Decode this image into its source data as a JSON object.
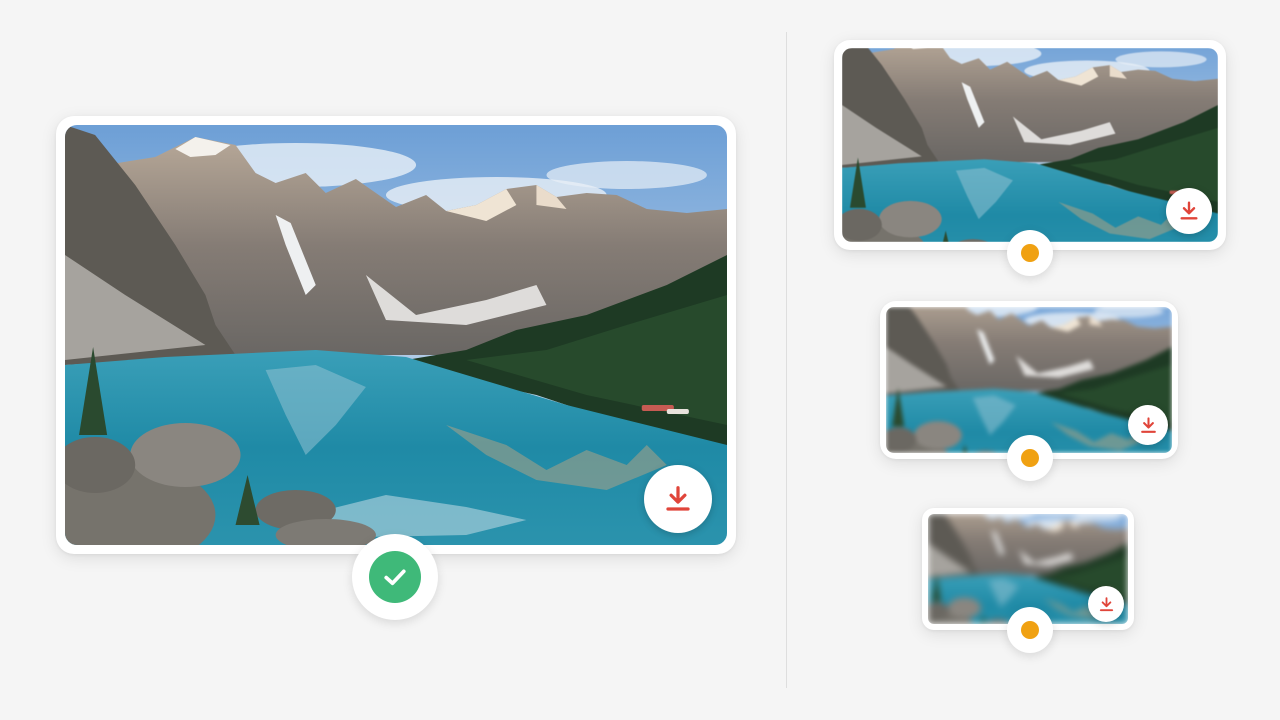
{
  "colors": {
    "background": "#f5f5f5",
    "card": "#ffffff",
    "download_icon": "#e0453a",
    "success_badge": "#3fb979",
    "pending_dot": "#f0a112"
  },
  "selected_image": {
    "state": "selected",
    "status_icon": "check-icon",
    "action_icon": "download-icon"
  },
  "variants": [
    {
      "state": "pending",
      "blur_level": "slight",
      "status_icon": "pending-dot-icon",
      "action_icon": "download-icon"
    },
    {
      "state": "pending",
      "blur_level": "medium",
      "status_icon": "pending-dot-icon",
      "action_icon": "download-icon"
    },
    {
      "state": "pending",
      "blur_level": "heavy",
      "status_icon": "pending-dot-icon",
      "action_icon": "download-icon"
    }
  ]
}
